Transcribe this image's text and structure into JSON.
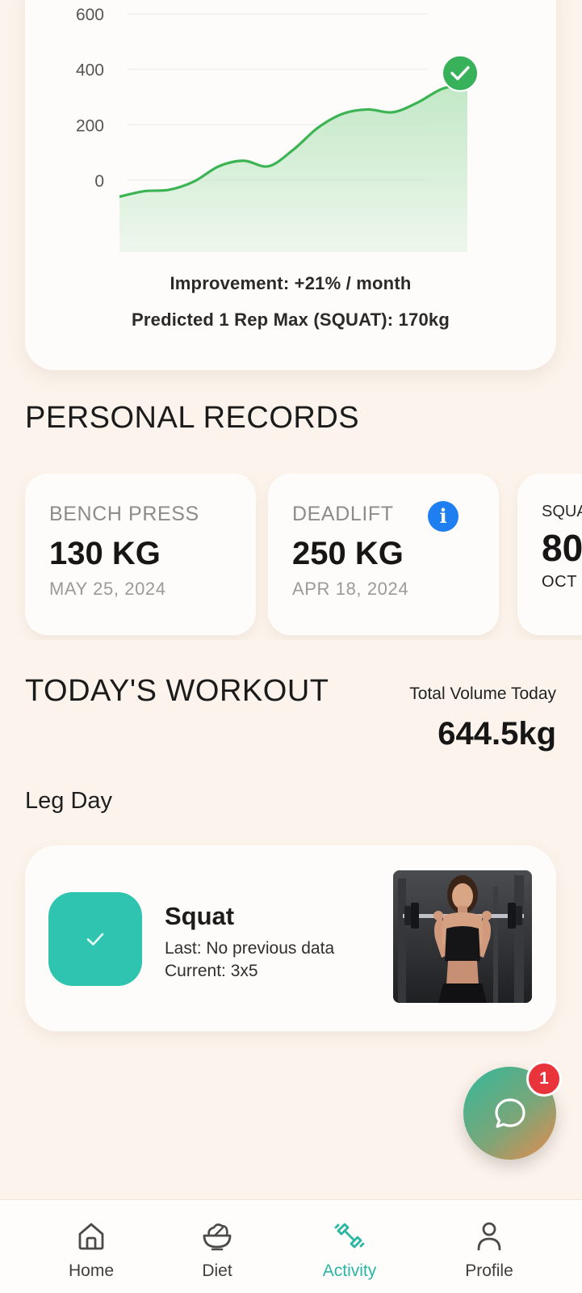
{
  "chart_data": {
    "type": "area",
    "x": [
      0,
      1,
      2,
      3,
      4,
      5,
      6,
      7,
      8,
      9,
      10,
      11,
      12,
      13,
      14
    ],
    "values": [
      -60,
      -40,
      -35,
      -5,
      50,
      70,
      50,
      110,
      190,
      240,
      255,
      245,
      280,
      330,
      345
    ],
    "ylim": [
      -260,
      650
    ],
    "yticks": [
      0,
      200,
      400,
      600
    ],
    "ytick_labels": [
      "600",
      "400",
      "200",
      "0"
    ],
    "grid": true,
    "line_color": "#3cb454",
    "fill_color": "#bfe7c4",
    "end_marker": "check-icon"
  },
  "chart": {
    "improvement": "Improvement: +21% / month",
    "prediction": "Predicted 1 Rep Max (SQUAT): 170kg"
  },
  "personal_records": {
    "title": "PERSONAL RECORDS",
    "items": [
      {
        "name": "BENCH PRESS",
        "value": "130 KG",
        "date": "MAY 25, 2024"
      },
      {
        "name": "DEADLIFT",
        "value": "250 KG",
        "date": "APR 18, 2024",
        "icon": "info-icon"
      },
      {
        "name": "SQUA",
        "value": "80",
        "date": "OCT 2"
      }
    ]
  },
  "workout": {
    "title": "TODAY'S WORKOUT",
    "total_label": "Total Volume Today",
    "total_value": "644.5kg",
    "day": "Leg Day",
    "exercise": {
      "name": "Squat",
      "last": "Last: No previous data",
      "current": "Current: 3x5"
    }
  },
  "chat": {
    "badge": "1",
    "icon": "chat-bubble-icon"
  },
  "nav": {
    "items": [
      {
        "label": "Home",
        "icon": "home-icon"
      },
      {
        "label": "Diet",
        "icon": "salad-bowl-icon"
      },
      {
        "label": "Activity",
        "icon": "dumbbell-icon",
        "active": true
      },
      {
        "label": "Profile",
        "icon": "person-icon"
      }
    ]
  },
  "colors": {
    "background": "#fcf4ec",
    "accent": "#2ec4b0",
    "active_nav": "#2bb5a2",
    "info": "#1f7ff0",
    "badge": "#e8343a"
  }
}
